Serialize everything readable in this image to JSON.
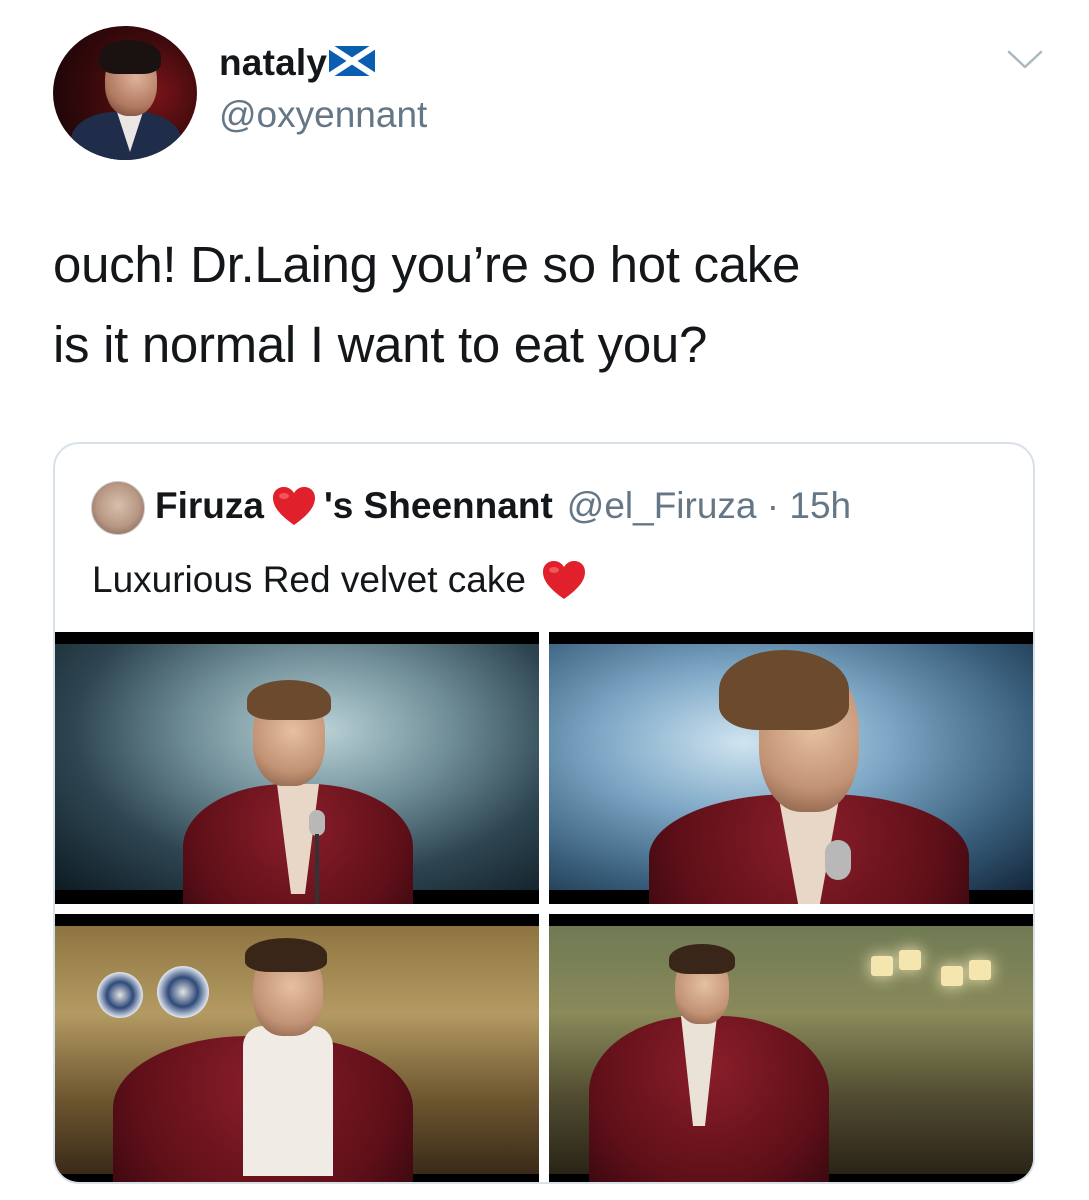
{
  "tweet": {
    "author_name": "nataly",
    "author_flag_icon": "scotland-flag-icon",
    "author_handle": "@oxyennant",
    "text_lines": [
      "ouch! Dr.Laing you’re so hot cake",
      "is it normal I want to eat you?"
    ]
  },
  "quoted_tweet": {
    "name_part1": "Firuza",
    "name_part2": "'s Sheennant",
    "handle_time": "@el_Firuza · 15h",
    "text": "Luxurious Red velvet cake",
    "heart_icon": "red-heart-icon",
    "heart_color": "#e0202a"
  },
  "colors": {
    "primary_text": "#14171a",
    "secondary_text": "#657786",
    "border": "#d9e1e8"
  }
}
